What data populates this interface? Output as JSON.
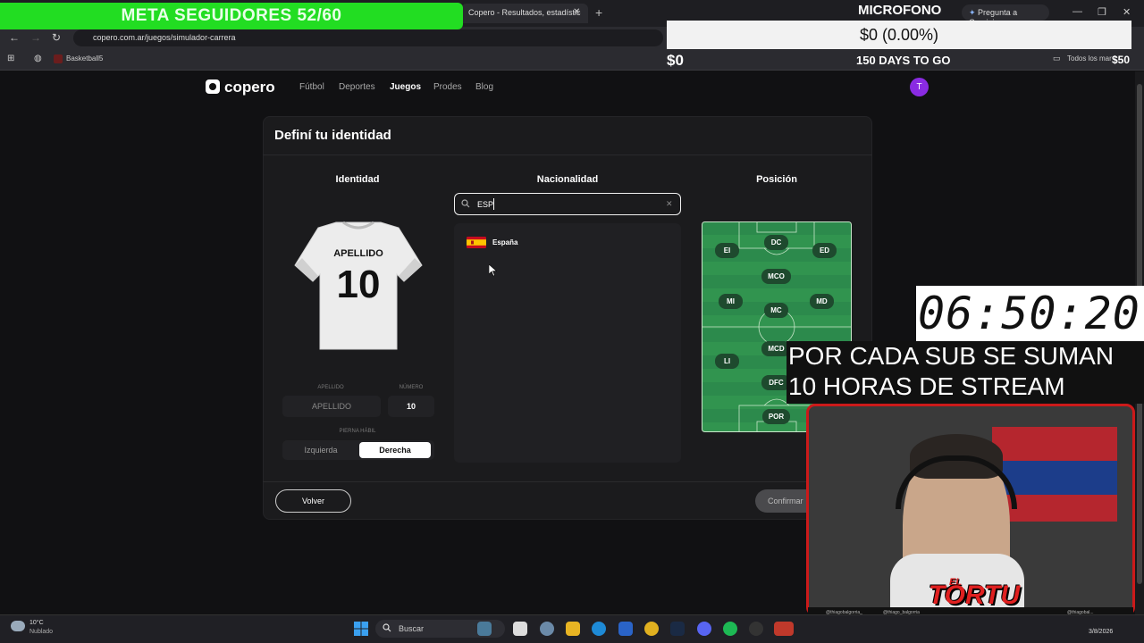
{
  "browser": {
    "tab_title": "Copero - Resultados, estadístic",
    "url": "copero.com.ar/juegos/simulador-carrera",
    "gemini_label": "Pregunta a Gemini",
    "bookmark_basketball": "Basketball5",
    "bookmark_all": "Todos los mar"
  },
  "overlay": {
    "meta_banner": "META SEGUIDORES 52/60",
    "mic_label": "MICROFONO",
    "money_box": "$0 (0.00%)",
    "money_left": "$0",
    "days_label": "150 DAYS TO GO",
    "money_right": "$50",
    "timer": "06:50:20",
    "sub_line1": "POR CADA SUB SE SUMAN",
    "sub_line2": "10 HORAS DE STREAM",
    "logo_el": "EL",
    "logo_tortu": "TORTU",
    "social_1": "@thiagobalgorria_",
    "social_2": "@thiago_balgorria",
    "social_3": "@thiagobal..."
  },
  "site": {
    "logo": "copero",
    "nav": [
      "Fútbol",
      "Deportes",
      "Juegos",
      "Prodes",
      "Blog"
    ],
    "avatar_initial": "T",
    "card_title": "Definí tu identidad",
    "identidad": {
      "title": "Identidad",
      "jersey_name": "APELLIDO",
      "jersey_number": "10",
      "apellido_label": "APELLIDO",
      "apellido_value": "APELLIDO",
      "numero_label": "NÚMERO",
      "numero_value": "10",
      "pierna_label": "PIERNA HÁBIL",
      "pierna_options": [
        "Izquierda",
        "Derecha"
      ],
      "pierna_selected": "Derecha"
    },
    "nacionalidad": {
      "title": "Nacionalidad",
      "search_value": "ESP",
      "results": [
        "España"
      ]
    },
    "posicion": {
      "title": "Posición",
      "positions": [
        "EI",
        "DC",
        "ED",
        "MCO",
        "MI",
        "MC",
        "MD",
        "LI",
        "MCD",
        "DFC",
        "POR"
      ]
    },
    "volver_label": "Volver",
    "confirmar_label": "Confirmar"
  },
  "taskbar": {
    "weather_temp": "10°C",
    "weather_desc": "Nublado",
    "search_placeholder": "Buscar",
    "date": "3/8/2026"
  },
  "colors": {
    "banner_green": "#22dd22",
    "pitch_green": "#2c8a4c",
    "cam_border": "#cc1a1a",
    "avatar_purple": "#8a2be2"
  }
}
